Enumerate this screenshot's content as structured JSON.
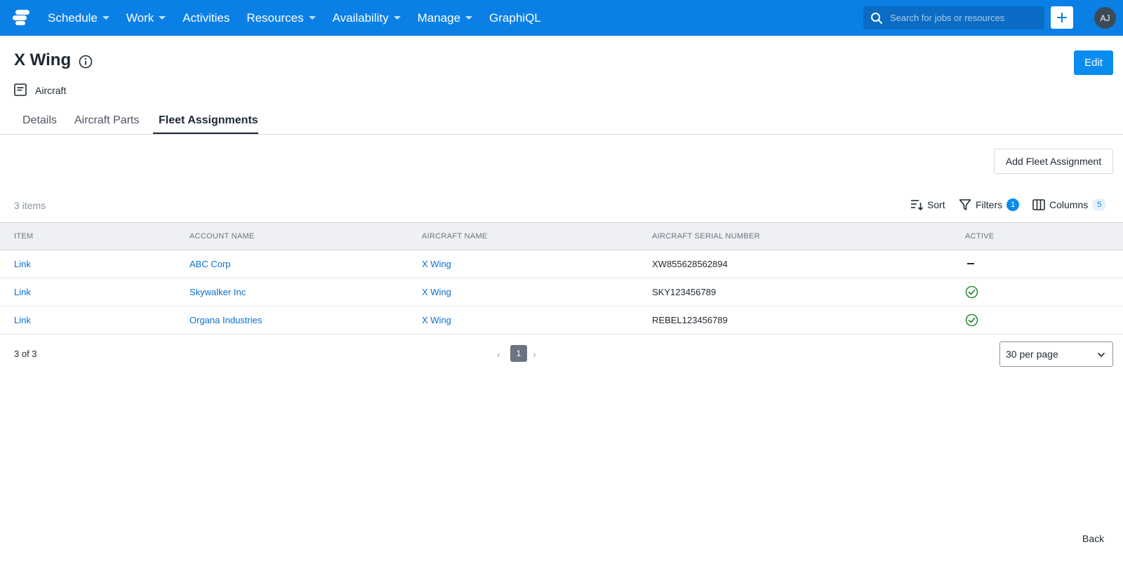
{
  "nav": {
    "items": [
      {
        "label": "Schedule",
        "has_menu": true
      },
      {
        "label": "Work",
        "has_menu": true
      },
      {
        "label": "Activities",
        "has_menu": false
      },
      {
        "label": "Resources",
        "has_menu": true
      },
      {
        "label": "Availability",
        "has_menu": true
      },
      {
        "label": "Manage",
        "has_menu": true
      },
      {
        "label": "GraphiQL",
        "has_menu": false
      }
    ],
    "search_placeholder": "Search for jobs or resources",
    "avatar_initials": "AJ"
  },
  "header": {
    "title": "X Wing",
    "type_label": "Aircraft",
    "edit_label": "Edit"
  },
  "tabs": [
    {
      "label": "Details",
      "active": false
    },
    {
      "label": "Aircraft Parts",
      "active": false
    },
    {
      "label": "Fleet Assignments",
      "active": true
    }
  ],
  "toolbar": {
    "add_label": "Add Fleet Assignment",
    "items_count": "3 items",
    "sort_label": "Sort",
    "filters_label": "Filters",
    "filters_count": "1",
    "columns_label": "Columns",
    "columns_count": "5"
  },
  "table": {
    "columns": [
      "ITEM",
      "ACCOUNT NAME",
      "AIRCRAFT NAME",
      "AIRCRAFT SERIAL NUMBER",
      "ACTIVE"
    ],
    "rows": [
      {
        "item": "Link",
        "account": "ABC Corp",
        "aircraft": "X Wing",
        "serial": "XW855628562894",
        "active": false
      },
      {
        "item": "Link",
        "account": "Skywalker Inc",
        "aircraft": "X Wing",
        "serial": "SKY123456789",
        "active": true
      },
      {
        "item": "Link",
        "account": "Organa Industries",
        "aircraft": "X Wing",
        "serial": "REBEL123456789",
        "active": true
      }
    ]
  },
  "pagination": {
    "summary": "3 of 3",
    "current_page": "1",
    "per_page": "30 per page"
  },
  "footer": {
    "back_label": "Back"
  },
  "colors": {
    "brand": "#0a7fe6",
    "button": "#0a8bf0",
    "link": "#0a6fd0",
    "active_check": "#2e8b3e"
  }
}
